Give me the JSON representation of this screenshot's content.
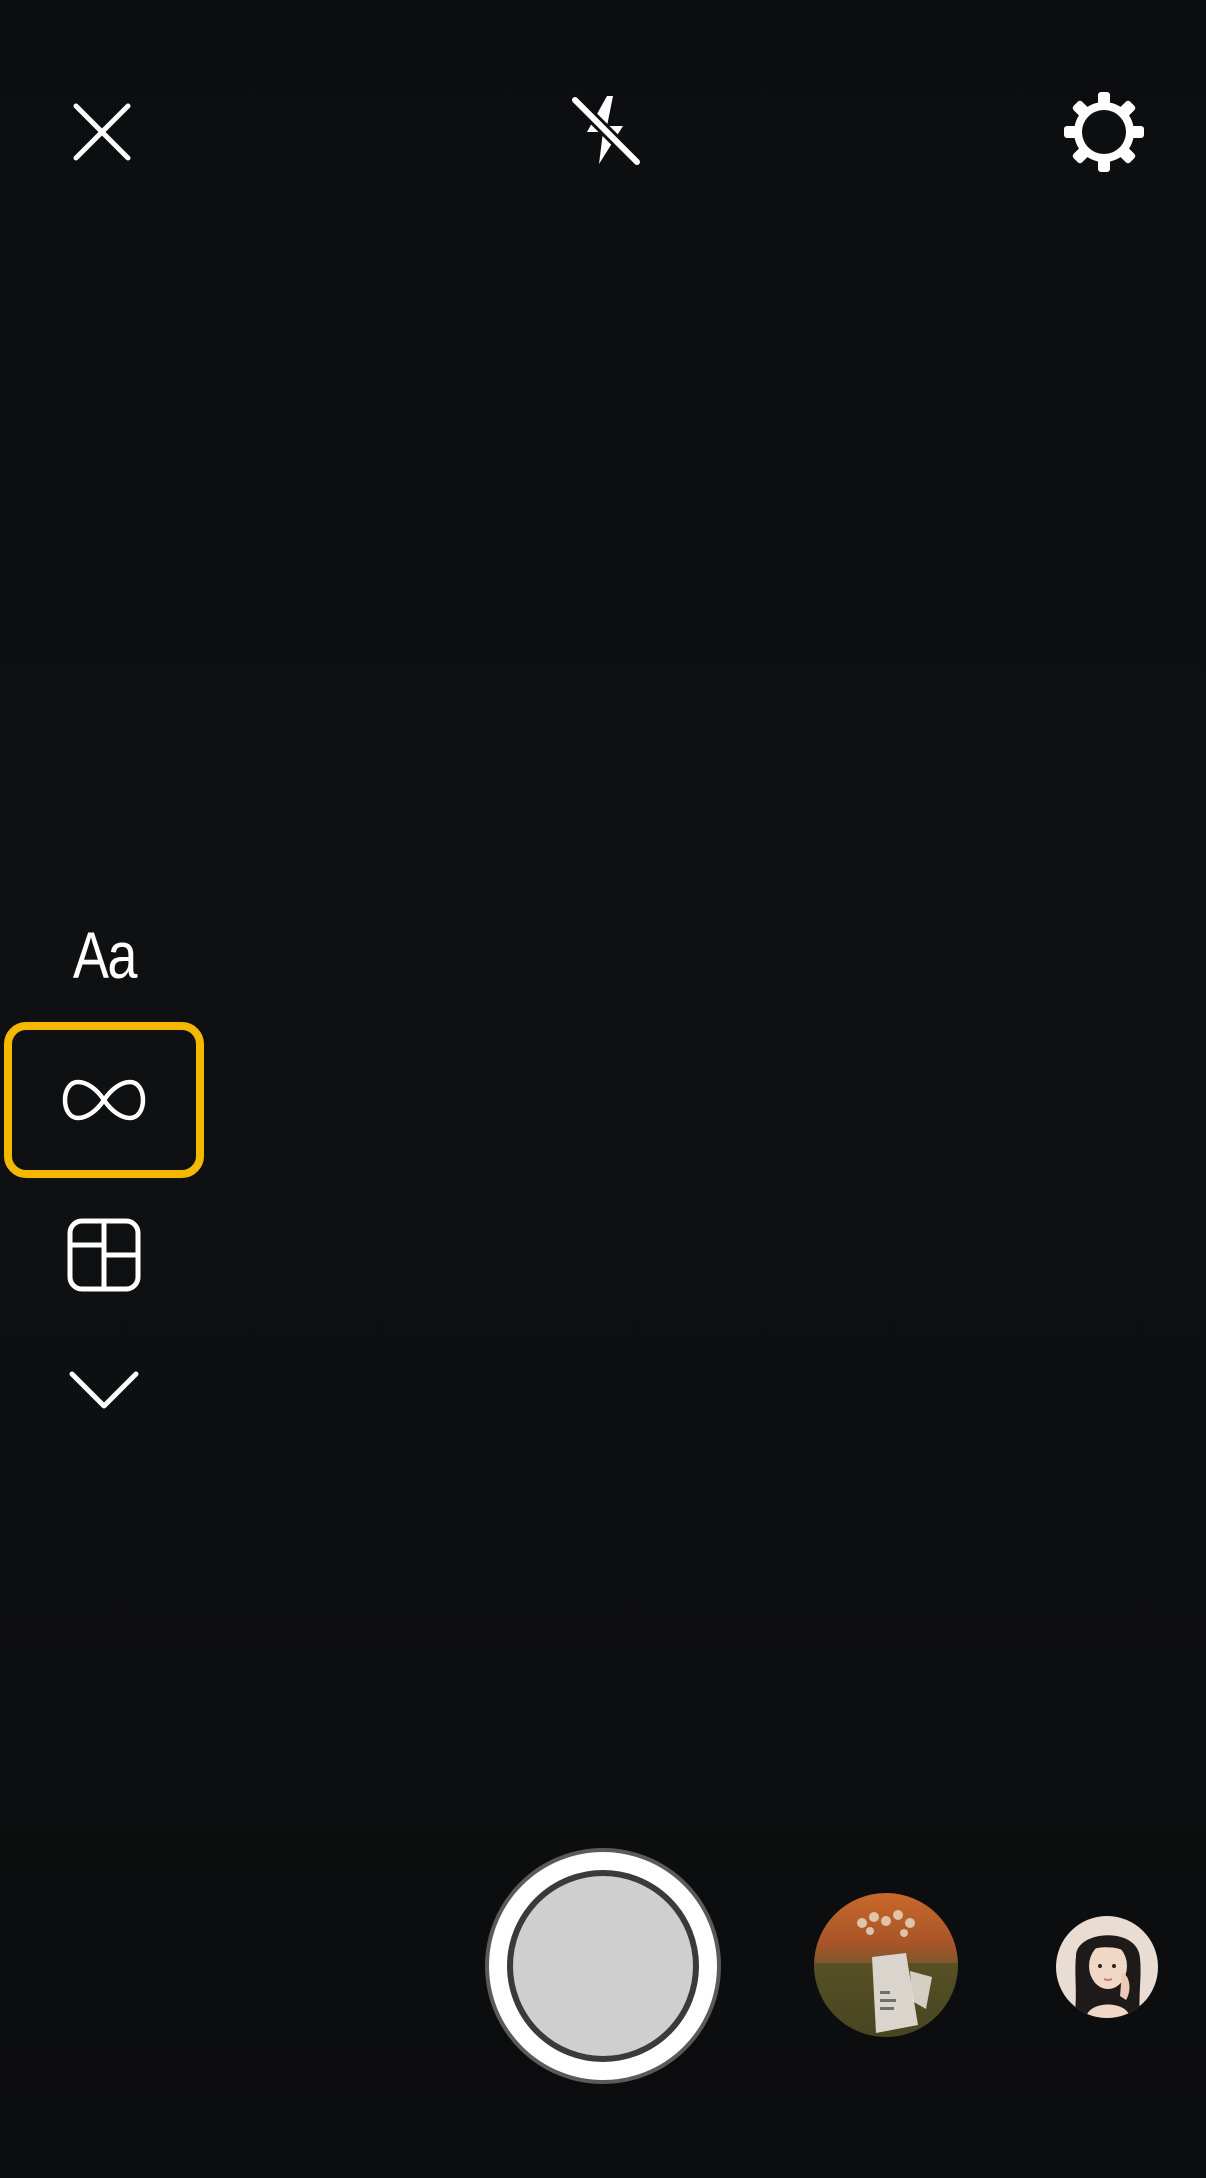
{
  "top_bar": {
    "close_icon": "close-icon",
    "flash_icon": "flash-off-icon",
    "settings_icon": "gear-icon"
  },
  "side_tools": {
    "text_tool_label": "Aa",
    "boomerang_icon": "infinity-icon",
    "layout_icon": "layout-grid-icon",
    "more_icon": "chevron-down-icon",
    "selected_tool": "boomerang",
    "highlight_color": "#f5b800"
  },
  "bottom_bar": {
    "shutter_icon": "shutter-button",
    "gallery_icon": "gallery-thumbnail",
    "profile_icon": "avatar"
  },
  "colors": {
    "background": "#0e0f10",
    "icon": "#ffffff",
    "accent": "#f5b800"
  }
}
